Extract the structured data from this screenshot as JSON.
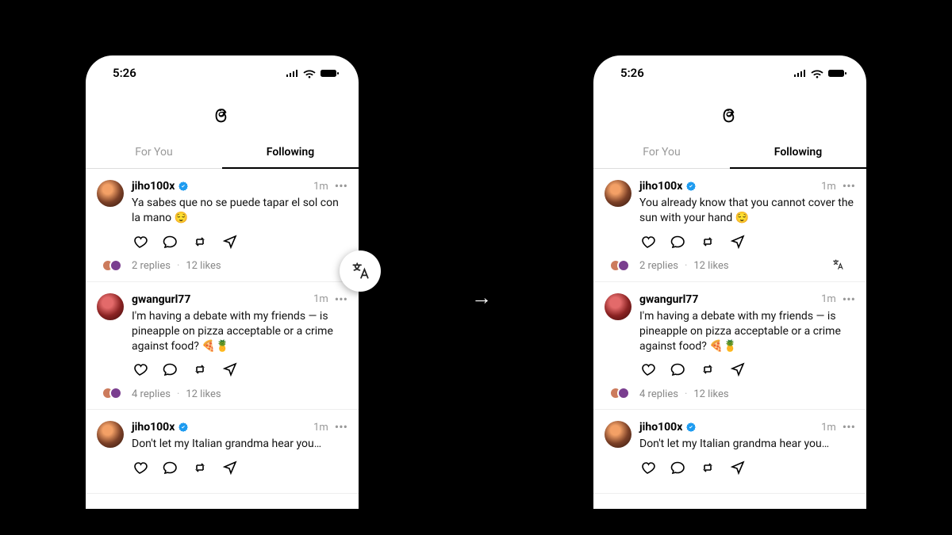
{
  "statusbar": {
    "time": "5:26"
  },
  "tabs": {
    "for_you": "For You",
    "following": "Following"
  },
  "phones": {
    "left": {
      "posts": [
        {
          "username": "jiho100x",
          "verified": true,
          "time": "1m",
          "text": "Ya sabes que no se puede tapar el sol con la mano 😌",
          "replies": "2 replies",
          "likes": "12 likes",
          "avatar": "type1"
        },
        {
          "username": "gwangurl77",
          "verified": false,
          "time": "1m",
          "text": "I'm having a debate with my friends — is pineapple on pizza acceptable or a crime against food? 🍕🍍",
          "replies": "4 replies",
          "likes": "12 likes",
          "avatar": "type2"
        },
        {
          "username": "jiho100x",
          "verified": true,
          "time": "1m",
          "text": "Don't let my Italian grandma hear you…",
          "replies": "",
          "likes": "",
          "avatar": "type1"
        }
      ]
    },
    "right": {
      "posts": [
        {
          "username": "jiho100x",
          "verified": true,
          "time": "1m",
          "text": "You already know that you cannot cover the sun with your hand 😌",
          "replies": "2 replies",
          "likes": "12 likes",
          "avatar": "type1",
          "translated": true
        },
        {
          "username": "gwangurl77",
          "verified": false,
          "time": "1m",
          "text": "I'm having a debate with my friends — is pineapple on pizza acceptable or a crime against food? 🍕🍍",
          "replies": "4 replies",
          "likes": "12 likes",
          "avatar": "type2"
        },
        {
          "username": "jiho100x",
          "verified": true,
          "time": "1m",
          "text": "Don't let my Italian grandma hear you…",
          "replies": "",
          "likes": "",
          "avatar": "type1"
        }
      ]
    }
  },
  "icons": {
    "translate": "translate-icon",
    "arrow": "→"
  }
}
